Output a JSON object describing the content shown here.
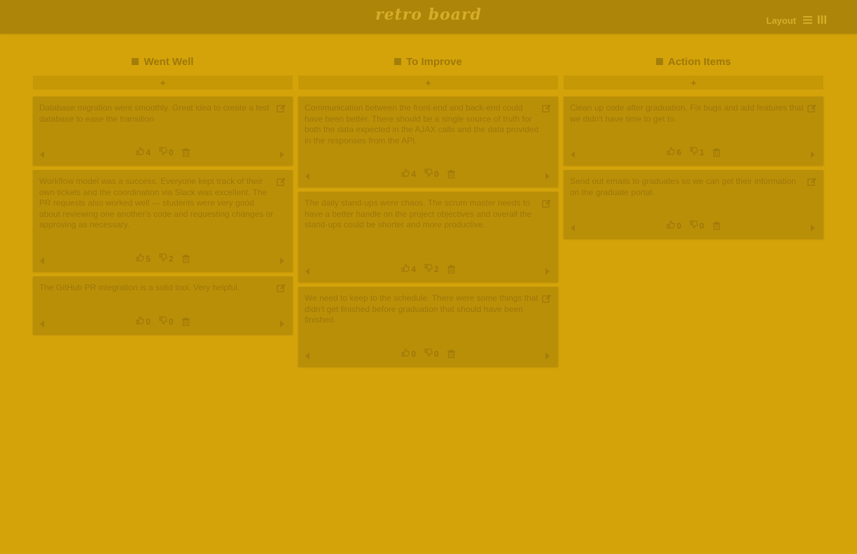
{
  "app": {
    "title": "retro board"
  },
  "header": {
    "layout_label": "Layout",
    "icons": [
      "list-layout-icon",
      "columns-layout-icon"
    ]
  },
  "colors": {
    "background": "#d4a30a",
    "header": "#ad8508",
    "card": "#ba8f08",
    "text": "#9d7708"
  },
  "columns": [
    {
      "title": "Went Well",
      "add_label": "+",
      "cards": [
        {
          "text": "Database migration went smoothly. Great idea to create a test database to ease the transition",
          "up": "4",
          "down": "0"
        },
        {
          "text": "Workflow model was a success. Everyone kept track of their own tickets and the coordination via Slack was excellent. The PR requests also worked well — students were very good about reviewing one another's code and requesting changes or approving as necessary.",
          "up": "5",
          "down": "2"
        },
        {
          "text": "The GitHub PR integration is a solid tool. Very helpful.",
          "up": "0",
          "down": "0"
        }
      ]
    },
    {
      "title": "To Improve",
      "add_label": "+",
      "cards": [
        {
          "text": "Communication between the front-end and back-end could have been better. There should be a single source of truth for both the data expected in the AJAX calls and the data provided in the responses from the API.",
          "up": "4",
          "down": "0"
        },
        {
          "text": "The daily stand-ups were chaos. The scrum master needs to have a better handle on the project objectives and overall the stand-ups could be shorter and more productive.",
          "up": "4",
          "down": "2"
        },
        {
          "text": "We need to keep to the schedule. There were some things that didn't get finished before graduation that should have been finished.",
          "up": "0",
          "down": "0"
        }
      ]
    },
    {
      "title": "Action Items",
      "add_label": "+",
      "cards": [
        {
          "text": "Clean up code after graduation. Fix bugs and add features that we didn't have time to get to.",
          "up": "6",
          "down": "1"
        },
        {
          "text": "Send out emails to graduates so we can get their information on the graduate portal.",
          "up": "0",
          "down": "0"
        }
      ]
    }
  ]
}
